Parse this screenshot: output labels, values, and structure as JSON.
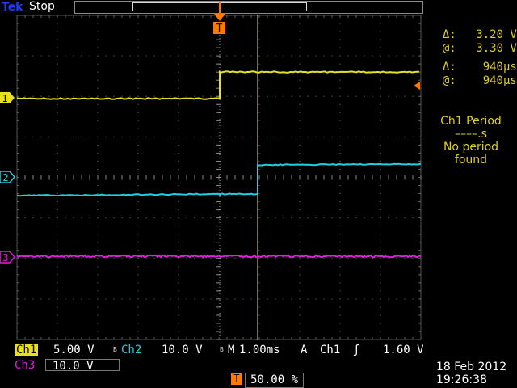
{
  "header": {
    "brand": "Tek",
    "acquisition_state": "Stop"
  },
  "markers": {
    "trigger_t": "T",
    "channels": [
      "1",
      "2",
      "3"
    ]
  },
  "cursor_readout": {
    "delta_v_label": "Δ:",
    "delta_v": "3.20 V",
    "at_v_label": "@:",
    "at_v": "3.30 V",
    "delta_t_label": "Δ:",
    "delta_t": "940µs",
    "at_t_label": "@:",
    "at_t": "940µs"
  },
  "measurement": {
    "title": "Ch1 Period",
    "value": "––––.s",
    "line3": "No period",
    "line4": "found"
  },
  "status": {
    "ch1_label": "Ch1",
    "ch1_scale": "5.00 V",
    "ch2_label": "Ch2",
    "ch2_scale": "10.0 V",
    "timebase_label": "M",
    "timebase": "1.00ms",
    "trigger_mode": "A",
    "trigger_source": "Ch1",
    "trigger_slope": "ʃ",
    "trigger_level": "1.60 V",
    "ch3_label": "Ch3",
    "ch3_scale": "10.0 V",
    "bw_mark": "B",
    "trigger_position": "50.00 %",
    "date": "18 Feb  2012",
    "time": "19:26:38"
  },
  "colors": {
    "ch1": "#e8e020",
    "ch2": "#20d0e0",
    "ch3": "#e020e0",
    "trigger": "#ff7800",
    "readout": "#e0d020"
  }
}
